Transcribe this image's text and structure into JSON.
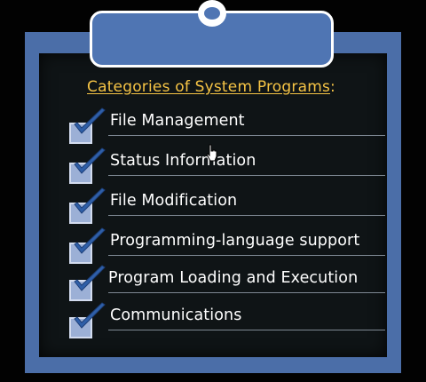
{
  "slide": {
    "heading": "Categories of System Programs",
    "heading_colon": ":",
    "items": [
      "File Management",
      "Status Information",
      "File Modification",
      "Programming-language support",
      "Program Loading and Execution",
      "Communications"
    ]
  },
  "icons": {
    "checkbox": "checkbox-checked-icon",
    "cursor": "hand-pointer-icon"
  },
  "colors": {
    "board": "#4b6ea8",
    "heading": "#f6c445",
    "text": "#ffffff"
  }
}
